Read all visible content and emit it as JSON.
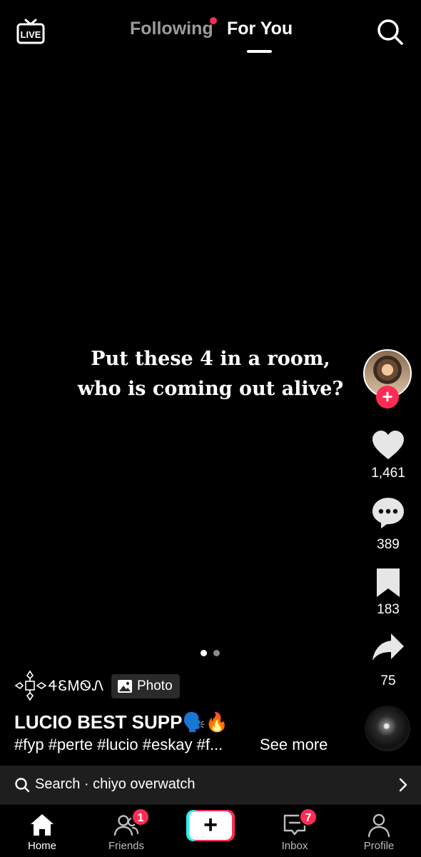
{
  "top": {
    "live_label": "LIVE",
    "tabs": [
      {
        "label": "Following",
        "active": false,
        "has_dot": true
      },
      {
        "label": "For You",
        "active": true
      }
    ]
  },
  "post": {
    "caption_line1": "Put these 4 in a room,",
    "caption_line2": "who is coming out alive?",
    "author": "ꫀ𝓮𝓶𝓸𝓷",
    "author_display": "ᏎᏋᎷᏫᏁ",
    "photo_badge": "Photo",
    "title": "LUCIO BEST SUPP🗣️🔥",
    "tags": "#fyp #perte #lucio #eskay #f...",
    "see_more": "See more",
    "pager": {
      "count": 2,
      "active": 0
    }
  },
  "rail": {
    "likes": "1,461",
    "comments": "389",
    "bookmarks": "183",
    "shares": "75"
  },
  "search": {
    "text": "Search · chiyo overwatch"
  },
  "nav": {
    "home": "Home",
    "friends": "Friends",
    "friends_badge": "1",
    "inbox": "Inbox",
    "inbox_badge": "7",
    "profile": "Profile"
  },
  "colors": {
    "accent": "#fe2c55",
    "cyan": "#25f4ee",
    "background": "#000000"
  },
  "icons": [
    "live-icon",
    "search-icon",
    "heart-icon",
    "comment-icon",
    "bookmark-icon",
    "share-icon",
    "image-icon",
    "chevron-right-icon",
    "home-icon",
    "friends-icon",
    "plus-icon",
    "inbox-icon",
    "profile-icon"
  ]
}
